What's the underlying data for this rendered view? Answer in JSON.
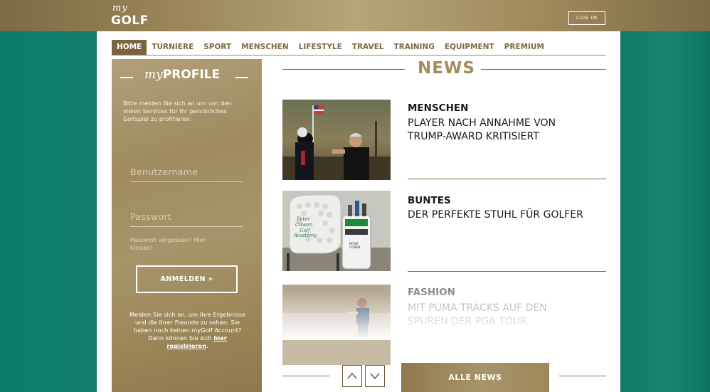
{
  "header": {
    "logo_my": "my",
    "logo_golf": "GOLF",
    "login_label": "LOG IN"
  },
  "nav": {
    "items": [
      "HOME",
      "TURNIERE",
      "SPORT",
      "MENSCHEN",
      "LIFESTYLE",
      "TRAVEL",
      "TRAINING",
      "EQUIPMENT",
      "PREMIUM"
    ],
    "active": "HOME"
  },
  "profile": {
    "title_my": "my",
    "title_profile": "PROFILE",
    "intro": "Bitte melden Sie sich an um von den vielen Services für Ihr persönliches Golfspiel zu profitieren.",
    "username_placeholder": "Benutzername",
    "password_placeholder": "Passwort",
    "forgot": "Passwort vergessen? Hier klicken!",
    "login_button": "ANMELDEN »",
    "bottom_text": "Melden Sie sich an, um Ihre Ergebnisse und die Ihrer Freunde zu sehen. Sie haben noch keinen myGolf Account? Dann können Sie sich",
    "register_link": "hier registrieren",
    "register_suffix": "."
  },
  "news": {
    "title": "NEWS",
    "items": [
      {
        "category": "MENSCHEN",
        "headline": "PLAYER NACH ANNAHME VON TRUMP-AWARD KRITISIERT"
      },
      {
        "category": "BUNTES",
        "headline": "DER PERFEKTE STUHL FÜR GOLFER"
      },
      {
        "category": "FASHION",
        "headline": "MIT PUMA TRACKS AUF DEN SPUREN DER PGA TOUR"
      }
    ],
    "chair_text": "Peter Cowen Golf Academy",
    "bag_text": "PETER COWEN",
    "all_news": "ALLE NEWS"
  },
  "colors": {
    "gold": "#a48c5b",
    "gold_dark": "#7a6440",
    "green": "#0f7e6a"
  },
  "icons": {
    "up": "chevron-up-icon",
    "down": "chevron-down-icon"
  }
}
